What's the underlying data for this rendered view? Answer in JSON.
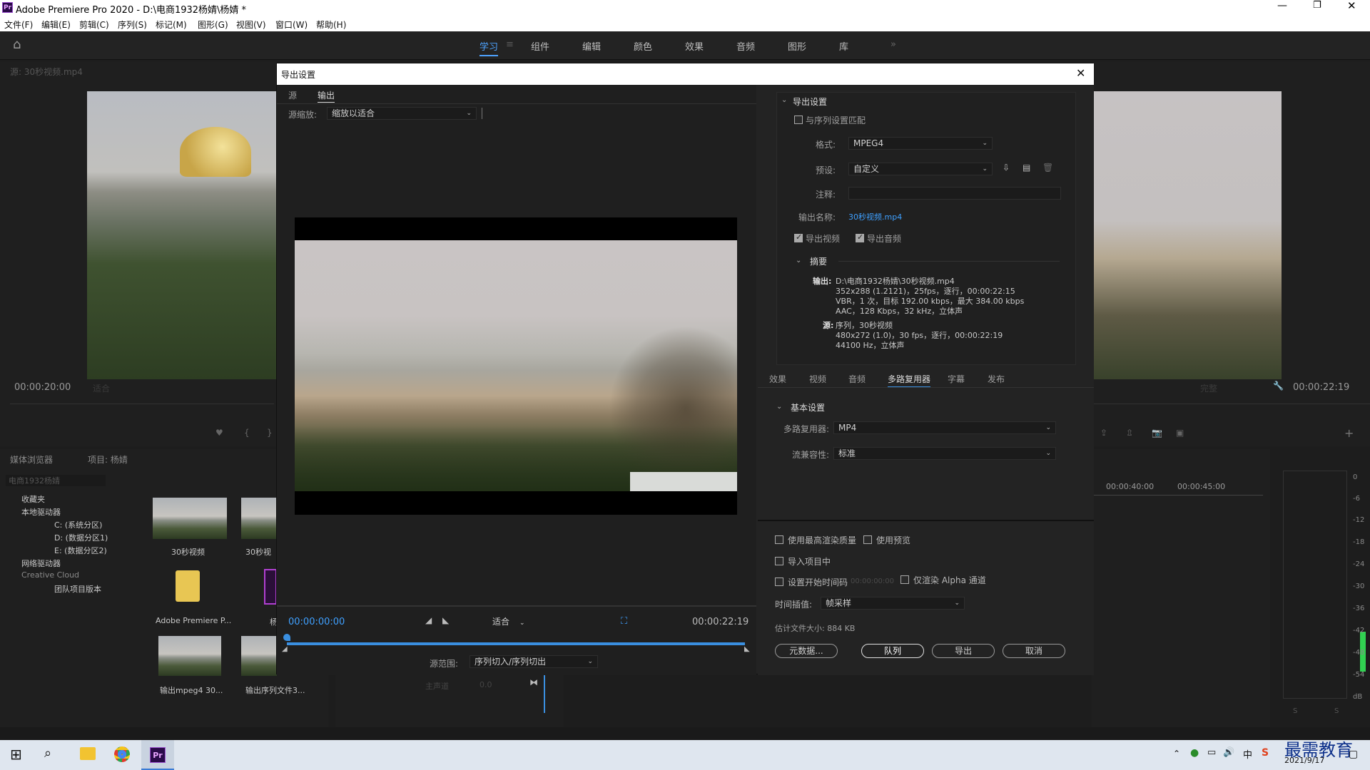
{
  "window": {
    "title": "Adobe Premiere Pro 2020 - D:\\电商1932杨婧\\杨婧 *"
  },
  "menu": [
    "文件(F)",
    "编辑(E)",
    "剪辑(C)",
    "序列(S)",
    "标记(M)",
    "图形(G)",
    "视图(V)",
    "窗口(W)",
    "帮助(H)"
  ],
  "workspaces": [
    "学习",
    "组件",
    "编辑",
    "颜色",
    "效果",
    "音频",
    "图形",
    "库"
  ],
  "source_panel": {
    "title": "源: 30秒视频.mp4",
    "timecode": "00:00:20:00",
    "fit": "适合"
  },
  "program_panel": {
    "timecode": "00:00:22:19",
    "quality": "完整"
  },
  "project_panel": {
    "tabs": [
      "媒体浏览器",
      "项目: 杨婧"
    ],
    "path": "电商1932杨婧",
    "tree": [
      "收藏夹",
      "本地驱动器",
      "C: (系统分区)",
      "D: (数据分区1)",
      "E: (数据分区2)",
      "网络驱动器",
      "Creative Cloud",
      "团队项目版本"
    ],
    "thumbs": [
      "30秒视频",
      "30秒视",
      "Adobe Premiere P...",
      "杨",
      "输出mpeg4 30...",
      "输出序列文件3..."
    ]
  },
  "timeline": {
    "ticks": [
      "00:00:40:00",
      "00:00:45:00"
    ],
    "track": "主声道",
    "vol": "0.0"
  },
  "meter": {
    "ticks": [
      "0",
      "-6",
      "-12",
      "-18",
      "-24",
      "-30",
      "-36",
      "-42",
      "-48",
      "-54",
      "dB"
    ],
    "solo": [
      "S",
      "S"
    ]
  },
  "dialog": {
    "title": "导出设置",
    "tabs": [
      "源",
      "输出"
    ],
    "source_scale_label": "源缩放:",
    "source_scale_value": "缩放以适合",
    "start_tc": "00:00:00:00",
    "end_tc": "00:00:22:19",
    "fit": "适合",
    "range_label": "源范围:",
    "range_value": "序列切入/序列切出",
    "export_settings": {
      "heading": "导出设置",
      "match_seq": "与序列设置匹配",
      "format_label": "格式:",
      "format_value": "MPEG4",
      "preset_label": "预设:",
      "preset_value": "自定义",
      "comment_label": "注释:",
      "output_name_label": "输出名称:",
      "output_name_value": "30秒视频.mp4",
      "export_video": "导出视频",
      "export_audio": "导出音频",
      "summary_heading": "摘要",
      "output_label": "输出:",
      "output_lines": [
        "D:\\电商1932杨婧\\30秒视频.mp4",
        "352x288 (1.2121)，25fps，逐行，00:00:22:15",
        "VBR，1 次，目标 192.00 kbps，最大 384.00 kbps",
        "AAC，128 Kbps，32  kHz，立体声"
      ],
      "source_label": "源:",
      "source_lines": [
        "序列，30秒视频",
        "480x272 (1.0)，30 fps，逐行，00:00:22:19",
        "44100 Hz，立体声"
      ]
    },
    "setting_tabs": [
      "效果",
      "视频",
      "音频",
      "多路复用器",
      "字幕",
      "发布"
    ],
    "basic": {
      "heading": "基本设置",
      "mux_label": "多路复用器:",
      "mux_value": "MP4",
      "compat_label": "流兼容性:",
      "compat_value": "标准"
    },
    "options": {
      "max_quality": "使用最高渲染质量",
      "use_previews": "使用预览",
      "import_project": "导入项目中",
      "start_tc": "设置开始时间码",
      "start_tc_value": "00:00:00:00",
      "alpha_only": "仅渲染 Alpha 通道",
      "interp_label": "时间插值:",
      "interp_value": "帧采样",
      "filesize": "估计文件大小: 884 KB"
    },
    "buttons": {
      "metadata": "元数据...",
      "queue": "队列",
      "export": "导出",
      "cancel": "取消"
    }
  },
  "taskbar": {
    "date": "2021/9/17",
    "ime": "中",
    "watermark": "最需教育"
  }
}
